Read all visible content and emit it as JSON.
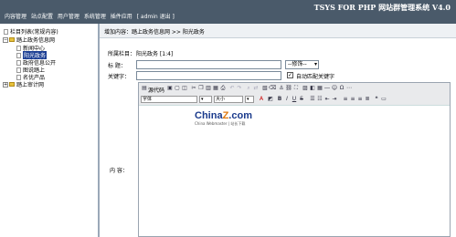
{
  "header": {
    "brand": "TSYS FOR PHP 网站群管理系统  V4.0",
    "nav": [
      "内容管理",
      "站点配置",
      "用户管理",
      "系统管理",
      "插件应用",
      "[ admin 退出 ]"
    ]
  },
  "tree": {
    "root": "栏目列表(常规内容)",
    "group1": "踏上政务信息网",
    "items": [
      "新闻中心",
      "阳光政务",
      "政府信息公开",
      "图说踏上",
      "名优产品"
    ],
    "group2": "踏上审计网"
  },
  "breadcrumb": "增加内容：踏上政务信息网 >> 阳光政务",
  "form": {
    "channel_label": "所属栏目：",
    "channel_value": "阳光政务 [1:4]",
    "title_label": "标    题：",
    "title_value": "",
    "style_select": "--修饰--",
    "keywords_label": "关键字：",
    "auto_keywords": "自动匹配关键字",
    "content_label": "内    容："
  },
  "editor": {
    "source_btn": "源代码",
    "font_select": "字体",
    "size_select": "大小",
    "logo_main": "China",
    "logo_z": "Z",
    "logo_tail": ".com",
    "logo_sub": "China Webmaster | 站长下载"
  }
}
